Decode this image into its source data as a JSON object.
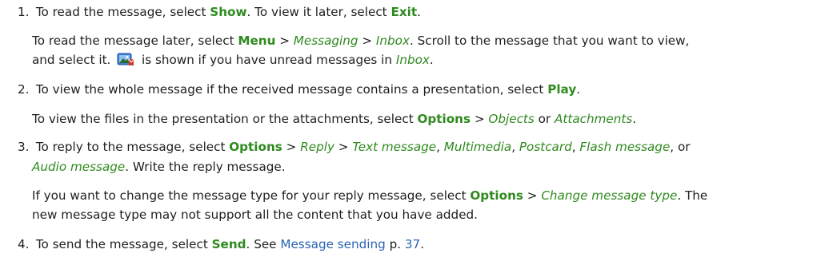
{
  "steps": [
    {
      "num": "1.",
      "text": [
        "To read the message, select ",
        "Show",
        ". To view it later, select ",
        "Exit",
        "."
      ],
      "sub": {
        "line1": [
          "To read the message later, select ",
          "Menu",
          " > ",
          "Messaging",
          " > ",
          "Inbox",
          ". Scroll to the message that you want to view,"
        ],
        "line2": [
          "and select it. ",
          " is shown if you have unread messages in ",
          "Inbox",
          "."
        ],
        "icon": "unread-multimedia-message-icon"
      }
    },
    {
      "num": "2.",
      "text": [
        "To view the whole message if the received message contains a presentation, select ",
        "Play",
        "."
      ],
      "sub": {
        "line1": [
          "To view the files in the presentation or the attachments, select ",
          "Options",
          " > ",
          "Objects",
          " or ",
          "Attachments",
          "."
        ]
      }
    },
    {
      "num": "3.",
      "line1": [
        "To reply to the message, select ",
        "Options",
        " > ",
        "Reply",
        " > ",
        "Text message",
        ", ",
        "Multimedia",
        ", ",
        "Postcard",
        ", ",
        "Flash message",
        ", or"
      ],
      "line2": [
        "Audio message",
        ". Write the reply message."
      ],
      "sub": {
        "line1": [
          "If you want to change the message type for your reply message, select ",
          "Options",
          " > ",
          "Change message type",
          ". The"
        ],
        "line2": [
          "new message type may not support all the content that you have added."
        ]
      }
    },
    {
      "num": "4.",
      "text": [
        "To send the message, select ",
        "Send",
        ". See ",
        "Message sending",
        " p. ",
        "37",
        "."
      ]
    }
  ],
  "colors": {
    "command": "#2f8a1f",
    "link": "#2a64b5",
    "text": "#1f1f1f"
  }
}
